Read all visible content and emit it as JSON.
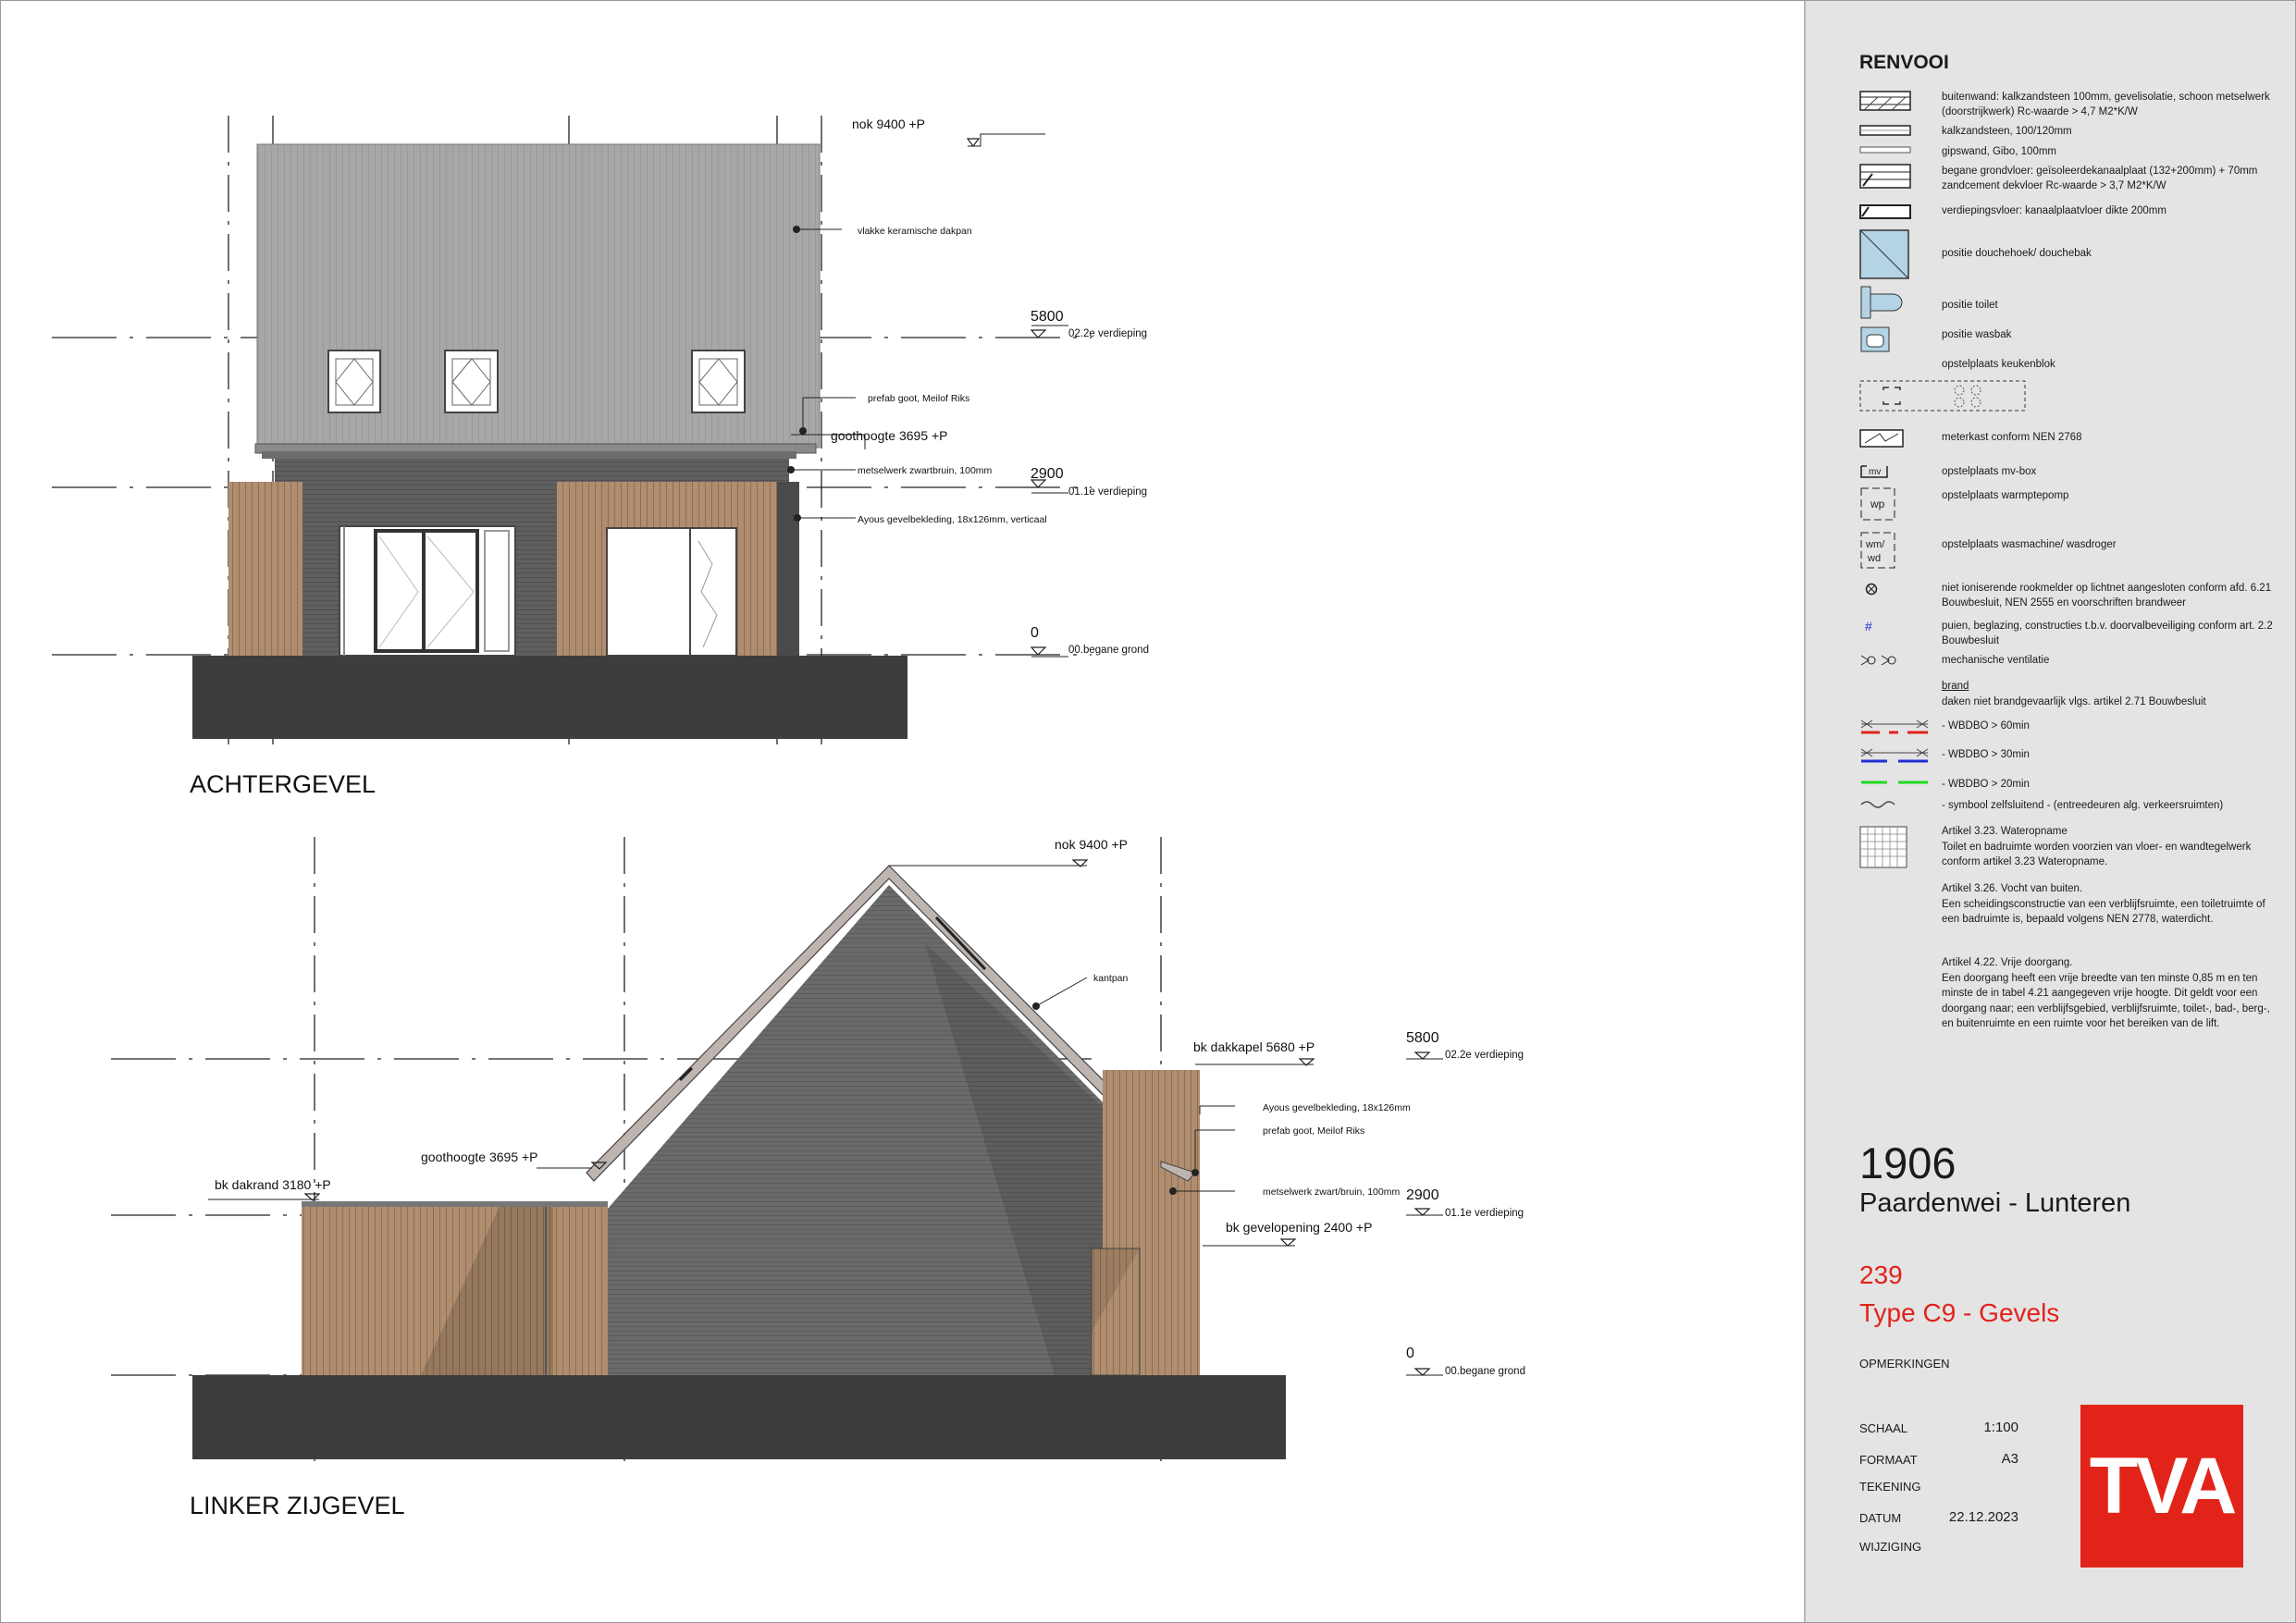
{
  "views": {
    "rear": {
      "title": "ACHTERGEVEL",
      "annotations": {
        "ridge": "nok 9400 +P",
        "roof_tiles": "vlakke keramische dakpan",
        "gutter": "prefab goot, Meilof Riks",
        "eaves": "goothoogte 3695 +P",
        "brick": "metselwerk zwartbruin, 100mm",
        "cladding": "Ayous gevelbekleding, 18x126mm, verticaal"
      },
      "levels": [
        {
          "value": "5800",
          "code": "02.2e verdieping"
        },
        {
          "value": "2900",
          "code": "01.1e verdieping"
        },
        {
          "value": "0",
          "code": "00.begane grond"
        }
      ]
    },
    "left": {
      "title": "LINKER ZIJGEVEL",
      "annotations": {
        "ridge": "nok 9400 +P",
        "edge_tile": "kantpan",
        "dormer": "bk dakkapel 5680 +P",
        "cladding": "Ayous gevelbekleding, 18x126mm",
        "gutter": "prefab goot, Meilof Riks",
        "eaves": "goothoogte 3695 +P",
        "roof_edge": "bk dakrand 3180 +P",
        "brick": "metselwerk zwart/bruin, 100mm",
        "opening": "bk gevelopening 2400 +P"
      },
      "levels": [
        {
          "value": "5800",
          "code": "02.2e verdieping"
        },
        {
          "value": "2900",
          "code": "01.1e verdieping"
        },
        {
          "value": "0",
          "code": "00.begane grond"
        }
      ]
    }
  },
  "legend": {
    "title": "RENVOOI",
    "items": [
      {
        "icon": "wall-hatch-icon",
        "text": "buitenwand: kalkzandsteen 100mm, gevelisolatie, schoon metselwerk (doorstrijkwerk) Rc-waarde > 4,7 M2*K/W"
      },
      {
        "icon": "limestone-icon",
        "text": "kalkzandsteen, 100/120mm"
      },
      {
        "icon": "drywall-icon",
        "text": "gipswand, Gibo, 100mm"
      },
      {
        "icon": "ground-floor-icon",
        "text": "begane grondvloer: geïsoleerdekanaalplaat (132+200mm) + 70mm zandcement dekvloer Rc-waarde > 3,7 M2*K/W"
      },
      {
        "icon": "floor-slab-icon",
        "text": "verdiepingsvloer: kanaalplaatvloer dikte 200mm"
      },
      {
        "icon": "shower-icon",
        "text": "positie douchehoek/ douchebak"
      },
      {
        "icon": "toilet-icon",
        "text": "positie toilet"
      },
      {
        "icon": "washbasin-icon",
        "text": "positie wasbak"
      },
      {
        "icon": "kitchen-icon",
        "text": "opstelplaats keukenblok"
      },
      {
        "icon": "meter-cabinet-icon",
        "text": "meterkast conform NEN 2768"
      },
      {
        "icon": "mv-box-icon",
        "text": "opstelplaats mv-box",
        "symbol": "mv"
      },
      {
        "icon": "heat-pump-icon",
        "text": "opstelplaats warmptepomp",
        "symbol": "wp"
      },
      {
        "icon": "washer-icon",
        "text": "opstelplaats wasmachine/ wasdroger",
        "symbol": "wm/\nwd"
      },
      {
        "icon": "smoke-detector-icon",
        "text": "niet ioniserende rookmelder op lichtnet aangesloten conform afd. 6.21 Bouwbesluit, NEN 2555 en voorschriften brandweer"
      },
      {
        "icon": "glazing-icon",
        "text": "puien, beglazing, constructies t.b.v. doorvalbeveiliging conform art. 2.2 Bouwbesluit",
        "symbol": "#"
      },
      {
        "icon": "ventilation-icon",
        "text": "mechanische ventilatie"
      }
    ],
    "fire_heading": "brand",
    "fire_intro": "daken niet brandgevaarlijk vlgs. artikel 2.71 Bouwbesluit",
    "fire_items": [
      {
        "text": "- WBDBO > 60min",
        "color": "#e2231a"
      },
      {
        "text": "- WBDBO > 30min",
        "color": "#1f2fd0"
      },
      {
        "text": "- WBDBO > 20min",
        "color": "#1fdc1f"
      },
      {
        "text": "- symbool zelfsluitend - (entreedeuren alg. verkeersruimten)",
        "color": "#444444"
      }
    ],
    "articles": [
      "Artikel 3.23. Wateropname\nToilet en badruimte worden voorzien van vloer- en wandtegelwerk conform artikel 3.23 Wateropname.",
      "Artikel 3.26. Vocht van buiten.\nEen scheidingsconstructie van een verblijfsruimte, een toiletruimte of een badruimte is, bepaald volgens NEN 2778, waterdicht.",
      "Artikel 4.22. Vrije doorgang.\nEen doorgang heeft een vrije breedte van ten minste 0,85 m en ten minste de in tabel 4.21 aangegeven vrije hoogte. Dit geldt voor een doorgang naar; een verblijfsgebied, verblijfsruimte, toilet-, bad-, berg-, en buitenruimte en een ruimte voor het bereiken van de lift."
    ]
  },
  "project": {
    "number": "1906",
    "location": "Paardenwei - Lunteren",
    "lot": "239",
    "drawing_title": "Type C9 - Gevels",
    "remarks_label": "OPMERKINGEN",
    "scale_label": "SCHAAL",
    "scale_value": "1:100",
    "format_label": "FORMAAT",
    "format_value": "A3",
    "drawing_label": "TEKENING",
    "date_label": "DATUM",
    "date_value": "22.12.2023",
    "revision_label": "WIJZIGING",
    "logo_text": "TVA"
  },
  "colors": {
    "roof": "#a6a6a6",
    "brick": "#5e5e5e",
    "wood": "#b08d6f",
    "ground": "#3d3d3d",
    "accent": "#e2231a"
  }
}
